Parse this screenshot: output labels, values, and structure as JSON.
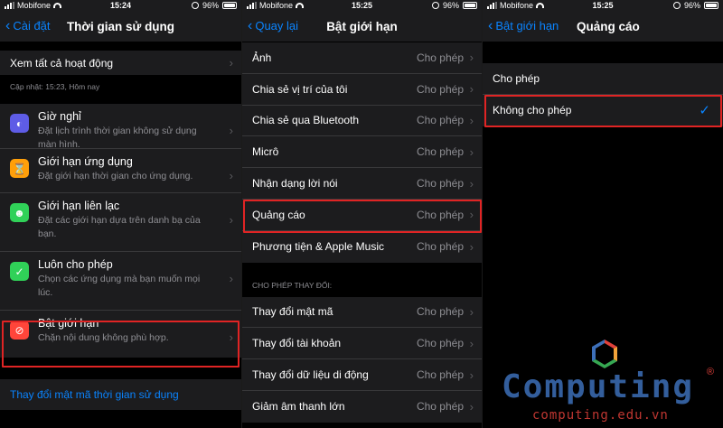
{
  "colors": {
    "accent": "#0a84ff",
    "highlight": "#e02424",
    "bg": "#000000",
    "cell": "#1c1c1e",
    "secondary_text": "#8e8e93"
  },
  "panel1": {
    "status": {
      "carrier": "Mobifone",
      "time": "15:24",
      "battery": "96%"
    },
    "nav": {
      "back": "Cài đặt",
      "title": "Thời gian sử dụng"
    },
    "see_all": "Xem tất cả hoạt động",
    "updated": "Cập nhật: 15:23, Hôm nay",
    "items": [
      {
        "icon": "downtime-icon",
        "title": "Giờ nghỉ",
        "subtitle": "Đặt lịch trình thời gian không sử dụng màn hình."
      },
      {
        "icon": "app-limits-icon",
        "title": "Giới hạn ứng dụng",
        "subtitle": "Đặt giới hạn thời gian cho ứng dụng."
      },
      {
        "icon": "communication-limits-icon",
        "title": "Giới hạn liên lạc",
        "subtitle": "Đặt các giới hạn dựa trên danh bạ của bạn."
      },
      {
        "icon": "always-allowed-icon",
        "title": "Luôn cho phép",
        "subtitle": "Chọn các ứng dụng mà bạn muốn mọi lúc."
      },
      {
        "icon": "restrictions-icon",
        "title": "Bật giới hạn",
        "subtitle": "Chặn nội dung không phù hợp."
      }
    ],
    "change_passcode": "Thay đổi mật mã thời gian sử dụng"
  },
  "panel2": {
    "status": {
      "carrier": "Mobifone",
      "time": "15:25",
      "battery": "96%"
    },
    "nav": {
      "back": "Quay lại",
      "title": "Bật giới hạn"
    },
    "rows": [
      {
        "label": "Ảnh",
        "value": "Cho phép"
      },
      {
        "label": "Chia sẻ vị trí của tôi",
        "value": "Cho phép"
      },
      {
        "label": "Chia sẻ qua Bluetooth",
        "value": "Cho phép"
      },
      {
        "label": "Micrô",
        "value": "Cho phép"
      },
      {
        "label": "Nhận dạng lời nói",
        "value": "Cho phép"
      },
      {
        "label": "Quảng cáo",
        "value": "Cho phép"
      },
      {
        "label": "Phương tiện & Apple Music",
        "value": "Cho phép"
      }
    ],
    "section_header": "CHO PHÉP THAY ĐỔI:",
    "rows2": [
      {
        "label": "Thay đổi mật mã",
        "value": "Cho phép"
      },
      {
        "label": "Thay đổi tài khoản",
        "value": "Cho phép"
      },
      {
        "label": "Thay đổi dữ liệu di động",
        "value": "Cho phép"
      },
      {
        "label": "Giảm âm thanh lớn",
        "value": "Cho phép"
      }
    ]
  },
  "panel3": {
    "status": {
      "carrier": "Mobifone",
      "time": "15:25",
      "battery": "96%"
    },
    "nav": {
      "back": "Bật giới hạn",
      "title": "Quảng cáo"
    },
    "options": [
      {
        "label": "Cho phép",
        "selected": false
      },
      {
        "label": "Không cho phép",
        "selected": true
      }
    ]
  },
  "watermark": {
    "name": "Computing",
    "reg": "®",
    "url": "computing.edu.vn"
  }
}
